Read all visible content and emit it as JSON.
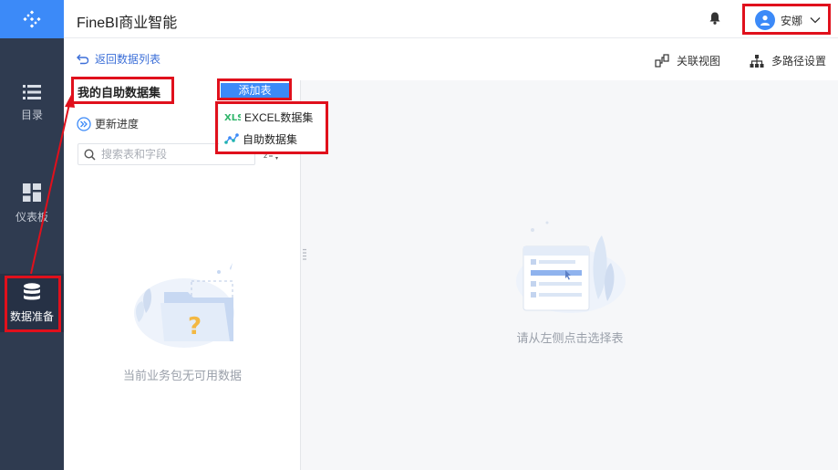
{
  "app": {
    "title": "FineBI商业智能"
  },
  "sidebar": {
    "items": [
      {
        "label": "目录",
        "icon": "list-icon"
      },
      {
        "label": "仪表板",
        "icon": "dashboard-icon"
      },
      {
        "label": "数据准备",
        "icon": "database-icon",
        "active": true
      }
    ]
  },
  "header": {
    "user_name": "安娜"
  },
  "toolbar": {
    "back_label": "返回数据列表",
    "relation_view_label": "关联视图",
    "multi_path_label": "多路径设置"
  },
  "left_panel": {
    "title": "我的自助数据集",
    "add_table_label": "添加表",
    "update_progress_label": "更新进度",
    "search_placeholder": "搜索表和字段",
    "empty_text": "当前业务包无可用数据"
  },
  "dropdown": {
    "items": [
      {
        "label": "EXCEL数据集",
        "icon": "excel-icon"
      },
      {
        "label": "自助数据集",
        "icon": "self-dataset-icon"
      }
    ]
  },
  "main": {
    "empty_text": "请从左侧点击选择表"
  },
  "colors": {
    "accent": "#3c8af8",
    "sidebar_bg": "#2f3b50",
    "highlight": "#e0101c"
  }
}
